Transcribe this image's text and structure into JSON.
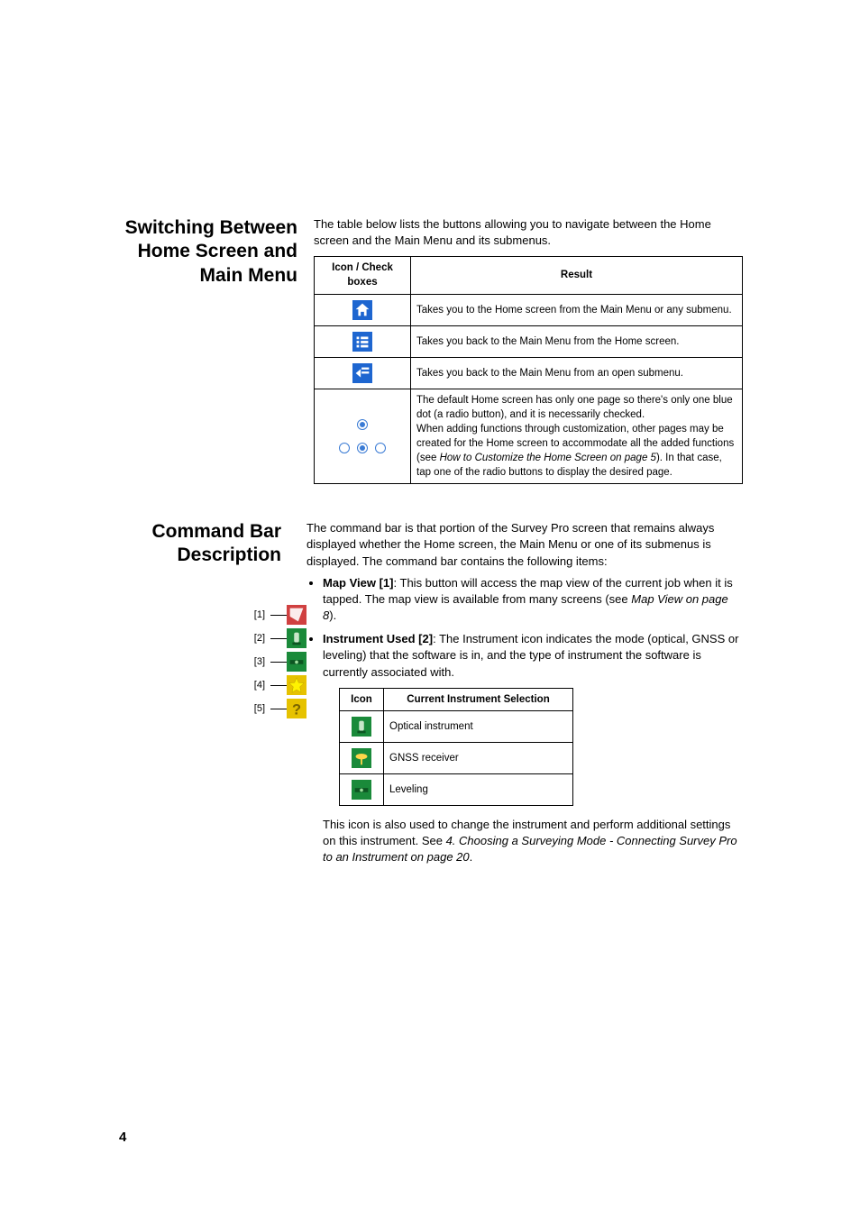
{
  "section1": {
    "heading": "Switching Between Home Screen and Main Menu",
    "intro": "The table below lists the buttons allowing you to navigate between the Home screen and the Main Menu and its submenus.",
    "table": {
      "headers": [
        "Icon / Check boxes",
        "Result"
      ],
      "rows": [
        {
          "icon": "home",
          "result": "Takes you to the Home screen from the Main Menu or any submenu."
        },
        {
          "icon": "list",
          "result": "Takes you back to the Main Menu from the Home screen."
        },
        {
          "icon": "back-arrow",
          "result": "Takes you back to the Main Menu from an open submenu."
        },
        {
          "icon": "radio-dots",
          "result_pre": "The default Home screen has only one page so there's only one blue dot (a radio button), and it is necessarily checked.\nWhen adding functions through customization, other pages may be created for the Home screen to accommodate all the added functions (see ",
          "result_ital": "How to Customize the Home Screen on page 5",
          "result_post": "). In that case, tap one of the radio buttons to display the desired page."
        }
      ]
    }
  },
  "section2": {
    "heading": "Command Bar Description",
    "intro": "The command bar is that portion of the Survey Pro screen that remains always displayed whether the Home screen, the Main Menu or one of its submenus is displayed. The command bar contains the following items:",
    "callouts": [
      "[1]",
      "[2]",
      "[3]",
      "[4]",
      "[5]"
    ],
    "bullets": [
      {
        "lead": "Map View [1]",
        "text": ": This button will access the map view of the current job when it is tapped. The map view is available from many screens (see ",
        "ital": "Map View on page 8",
        "tail": ")."
      },
      {
        "lead": "Instrument Used [2]",
        "text": ": The Instrument icon indicates the mode (optical, GNSS or leveling) that the software is in, and the type of instrument the software is currently associated with."
      }
    ],
    "instr_table": {
      "headers": [
        "Icon",
        "Current Instrument Selection"
      ],
      "rows": [
        {
          "icon": "optical",
          "label": "Optical instrument"
        },
        {
          "icon": "gnss",
          "label": "GNSS receiver"
        },
        {
          "icon": "leveling",
          "label": "Leveling"
        }
      ]
    },
    "para2_pre": "This icon is also used to change the instrument and perform additional settings on this instrument. See ",
    "para2_ital": "4. Choosing a Surveying Mode - Connecting Survey Pro to an Instrument on page 20",
    "para2_post": "."
  },
  "page_number": "4"
}
